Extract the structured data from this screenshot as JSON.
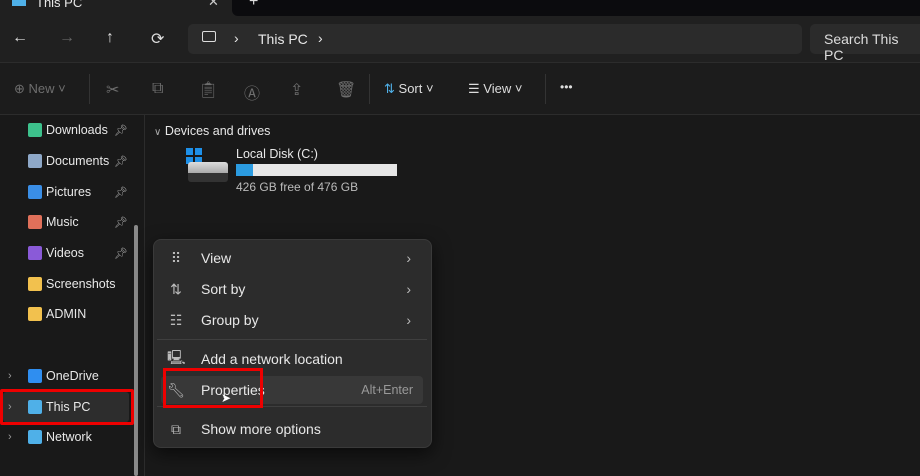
{
  "tab": {
    "title": "This PC",
    "close": "✕",
    "new": "+"
  },
  "nav": {
    "back": "←",
    "forward": "→",
    "up": "↑",
    "refresh": "⟳"
  },
  "breadcrumb": {
    "items": [
      "This PC"
    ],
    "sep": "›"
  },
  "search": {
    "placeholder": "Search This PC"
  },
  "toolbar": {
    "new": "New",
    "sort": "Sort",
    "view": "View",
    "more": "•••"
  },
  "sidebar": {
    "items": [
      {
        "label": "Downloads",
        "pinned": true,
        "color": "#3dc18c"
      },
      {
        "label": "Documents",
        "pinned": true,
        "color": "#8ea8c8"
      },
      {
        "label": "Pictures",
        "pinned": true,
        "color": "#3a8ee6"
      },
      {
        "label": "Music",
        "pinned": true,
        "color": "#e0705a"
      },
      {
        "label": "Videos",
        "pinned": true,
        "color": "#8a5ad8"
      },
      {
        "label": "Screenshots",
        "pinned": false,
        "color": "#f2c14e"
      },
      {
        "label": "ADMIN",
        "pinned": false,
        "color": "#f2c14e"
      },
      {
        "label": "OneDrive",
        "color": "#2f8ef0"
      },
      {
        "label": "This PC",
        "color": "#4fb0e8"
      },
      {
        "label": "Network",
        "color": "#4fb0e8"
      }
    ]
  },
  "content": {
    "section": "Devices and drives",
    "drive": {
      "name": "Local Disk (C:)",
      "free": "426 GB free of 476 GB",
      "used_fraction": 0.105
    }
  },
  "context_menu": {
    "items": [
      {
        "label": "View",
        "icon": "grid-icon"
      },
      {
        "label": "Sort by",
        "icon": "sort-icon"
      },
      {
        "label": "Group by",
        "icon": "group-icon"
      },
      {
        "label": "Add a network location",
        "icon": "network-icon"
      },
      {
        "label": "Properties",
        "icon": "wrench-icon",
        "shortcut": "Alt+Enter"
      },
      {
        "label": "Show more options",
        "icon": "expand-icon"
      }
    ]
  }
}
